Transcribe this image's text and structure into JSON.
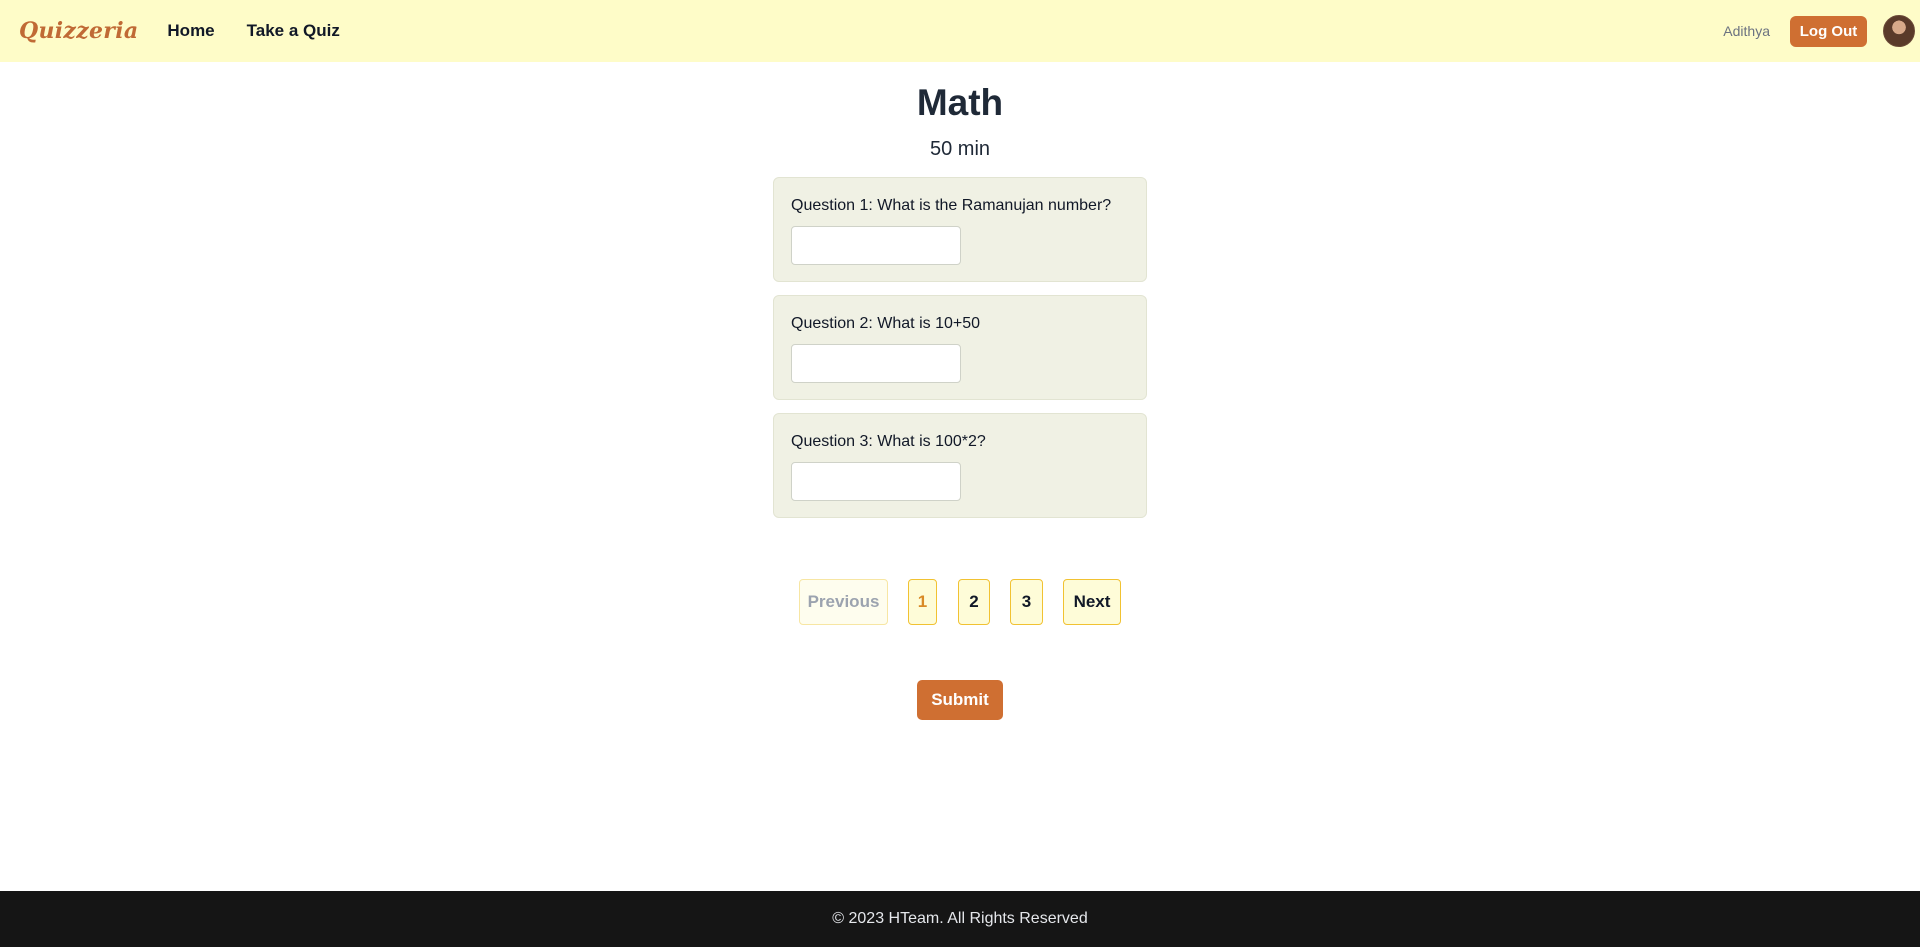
{
  "navbar": {
    "brand": "Quizzeria",
    "links": [
      "Home",
      "Take a Quiz"
    ],
    "username": "Adithya",
    "logout_label": "Log Out"
  },
  "quiz": {
    "title": "Math",
    "duration": "50 min",
    "questions": [
      {
        "text": "Question 1: What is the Ramanujan number?",
        "answer": ""
      },
      {
        "text": "Question 2: What is 10+50",
        "answer": ""
      },
      {
        "text": "Question 3: What is 100*2?",
        "answer": ""
      }
    ]
  },
  "pagination": {
    "previous_label": "Previous",
    "pages": [
      "1",
      "2",
      "3"
    ],
    "current_page": "1",
    "next_label": "Next"
  },
  "submit_label": "Submit",
  "footer": {
    "text": "© 2023 HTeam. All Rights Reserved"
  },
  "colors": {
    "navbar_bg": "#fefcc8",
    "accent": "#cf6f32",
    "card_bg": "#f0f1e4",
    "footer_bg": "#151515",
    "page_border": "#f1c232"
  }
}
